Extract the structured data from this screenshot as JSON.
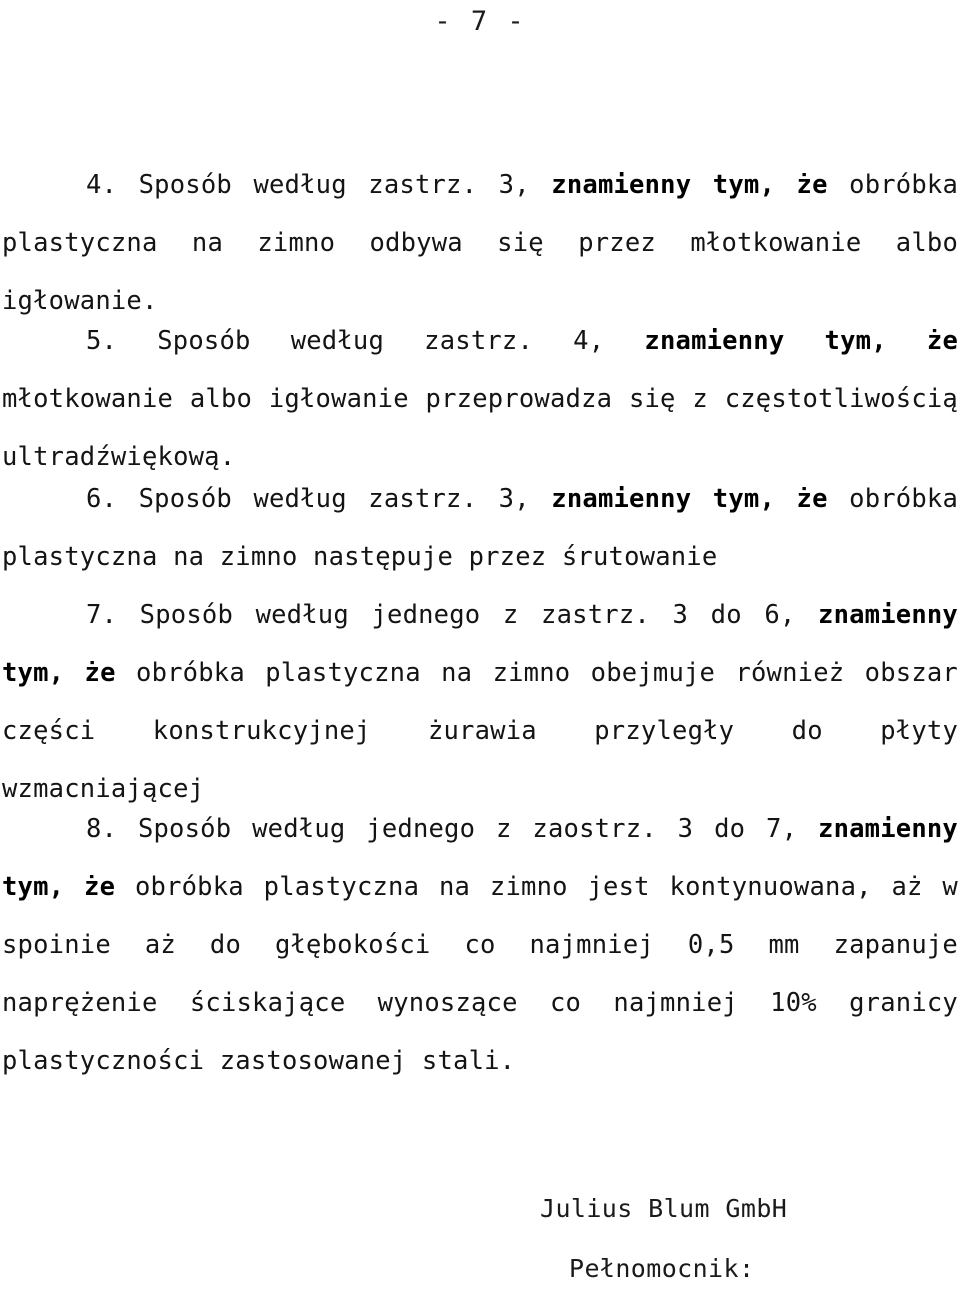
{
  "document": {
    "page_number_label": "- 7 -",
    "language": "pl"
  },
  "claims": [
    {
      "number": "4.",
      "lead": "4. Sposób według zastrz. 3, ",
      "emphasis": "znamienny tym, że",
      "rest": " obróbka plastyczna na zimno odbywa się przez młotkowanie albo igłowanie.",
      "full_text": "4. Sposób według zastrz. 3, znamienny tym, że obróbka plastyczna na zimno odbywa się przez młotkowanie albo igłowanie."
    },
    {
      "number": "5.",
      "lead": "5. Sposób według zastrz. 4, ",
      "emphasis": "znamienny tym, że",
      "rest": " młotkowanie albo igłowanie przeprowadza się z częstotliwością ultradźwiękową.",
      "full_text": "5. Sposób według zastrz. 4, znamienny tym, że młotkowanie albo igłowanie przeprowadza się z częstotliwością ultradźwiękową."
    },
    {
      "number": "6.",
      "lead": "6. Sposób według zastrz. 3, ",
      "emphasis": "znamienny tym, że",
      "rest": " obróbka plastyczna na zimno następuje przez śrutowanie",
      "full_text": "6. Sposób według zastrz. 3, znamienny tym, że obróbka plastyczna na zimno następuje przez śrutowanie"
    },
    {
      "number": "7.",
      "lead": "7. Sposób według jednego z zastrz. 3 do 6, ",
      "emphasis": "znamienny tym, że",
      "rest": " obróbka plastyczna na zimno obejmuje również obszar części konstrukcyjnej żurawia przyległy do płyty wzmacniającej",
      "full_text": "7. Sposób według jednego z zastrz. 3 do 6, znamienny tym, że obróbka plastyczna na zimno obejmuje również obszar części konstrukcyjnej żurawia przyległy do płyty wzmacniającej"
    },
    {
      "number": "8.",
      "lead": "8. Sposób według jednego z zaostrz. 3 do 7, ",
      "emphasis": "znamienny tym, że",
      "rest": " obróbka plastyczna na zimno jest kontynuowana, aż w spoinie aż do głębokości co najmniej 0,5 mm zapanuje naprężenie ściskające wynoszące co najmniej 10% granicy plastyczności zastosowanej stali.",
      "full_text": "8. Sposób według jednego z zaostrz. 3 do 7, znamienny tym, że obróbka plastyczna na zimno jest kontynuowana, aż w spoinie aż do głębokości co najmniej 0,5 mm zapanuje naprężenie ściskające wynoszące co najmniej 10% granicy plastyczności zastosowanej stali."
    }
  ],
  "signature": {
    "company": "Julius Blum GmbH",
    "role": "Pełnomocnik:"
  }
}
